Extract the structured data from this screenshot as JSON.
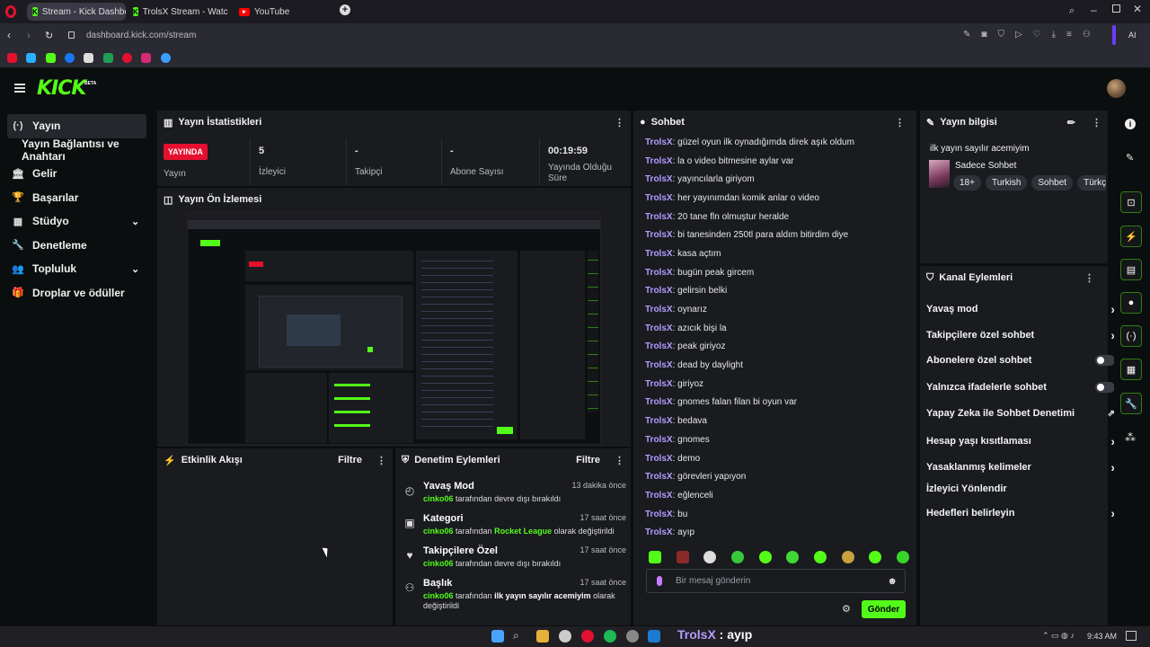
{
  "browser": {
    "tabs": [
      {
        "title": "Stream - Kick Dashboard"
      },
      {
        "title": "TrolsX Stream - Watch Liv"
      },
      {
        "title": "YouTube"
      }
    ],
    "new_tab": "+",
    "url": "dashboard.kick.com/stream",
    "ai_label": "AI"
  },
  "header": {
    "logo": "KICK",
    "logo_tag": "BETA"
  },
  "nav": {
    "items": [
      {
        "label": "Yayın",
        "icon": "broadcast-icon"
      },
      {
        "label": "Yayın Bağlantısı ve Anahtarı"
      },
      {
        "label": "Gelir",
        "icon": "bank-icon"
      },
      {
        "label": "Başarılar",
        "icon": "trophy-icon"
      },
      {
        "label": "Stüdyo",
        "icon": "studio-icon"
      },
      {
        "label": "Denetleme",
        "icon": "wrench-icon"
      },
      {
        "label": "Topluluk",
        "icon": "community-icon"
      },
      {
        "label": "Droplar ve ödüller",
        "icon": "drops-icon"
      }
    ]
  },
  "stats": {
    "title": "Yayın İstatistikleri",
    "live_badge": "YAYINDA",
    "live_label": "Yayın",
    "viewers_value": "5",
    "viewers_label": "İzleyici",
    "followers_value": "-",
    "followers_label": "Takipçi",
    "subs_value": "-",
    "subs_label": "Abone Sayısı",
    "duration_value": "00:19:59",
    "duration_label": "Yayında Olduğu Süre"
  },
  "preview": {
    "title": "Yayın Ön İzlemesi"
  },
  "activity": {
    "title": "Etkinlik Akışı",
    "filter": "Filtre"
  },
  "mod": {
    "title": "Denetim Eylemleri",
    "filter": "Filtre",
    "items": [
      {
        "title": "Yavaş Mod",
        "time": "13 dakika önce",
        "user": "cinko06",
        "pre": " tarafından devre dışı bırakıldı",
        "hl": "",
        "post": ""
      },
      {
        "title": "Kategori",
        "time": "17 saat önce",
        "user": "cinko06",
        "pre": " tarafından ",
        "hl": "Rocket League",
        "post": " olarak değiştirildi"
      },
      {
        "title": "Takipçilere Özel",
        "time": "17 saat önce",
        "user": "cinko06",
        "pre": " tarafından devre dışı bırakıldı",
        "hl": "",
        "post": ""
      },
      {
        "title": "Başlık",
        "time": "17 saat önce",
        "user": "cinko06",
        "pre": " tarafından ",
        "hl": "ilk yayın sayılır acemiyim",
        "post": " olarak değiştirildi"
      }
    ]
  },
  "chat": {
    "title": "Sohbet",
    "messages": [
      {
        "user": "TrolsX",
        "text": ": güzel oyun ilk oynadığımda direk aşık oldum"
      },
      {
        "user": "TrolsX",
        "text": ": la o video bitmesine aylar var"
      },
      {
        "user": "TrolsX",
        "text": ": yayıncılarla giriyom"
      },
      {
        "user": "TrolsX",
        "text": ": her yayınımdan komik anlar o video"
      },
      {
        "user": "TrolsX",
        "text": ": 20 tane fln olmuştur heralde"
      },
      {
        "user": "TrolsX",
        "text": ": bi tanesinden 250tl para aldım bitirdim diye"
      },
      {
        "user": "TrolsX",
        "text": ": kasa açtım"
      },
      {
        "user": "TrolsX",
        "text": ": bugün peak gircem"
      },
      {
        "user": "TrolsX",
        "text": ": gelirsin belki"
      },
      {
        "user": "TrolsX",
        "text": ": oynarız"
      },
      {
        "user": "TrolsX",
        "text": ": azıcık bişi la"
      },
      {
        "user": "TrolsX",
        "text": ": peak giriyoz"
      },
      {
        "user": "TrolsX",
        "text": ": dead by daylight"
      },
      {
        "user": "TrolsX",
        "text": ": giriyoz"
      },
      {
        "user": "TrolsX",
        "text": ": gnomes falan filan bi oyun var"
      },
      {
        "user": "TrolsX",
        "text": ": bedava"
      },
      {
        "user": "TrolsX",
        "text": ": gnomes"
      },
      {
        "user": "TrolsX",
        "text": ": demo"
      },
      {
        "user": "TrolsX",
        "text": ": görevleri yapıyon"
      },
      {
        "user": "TrolsX",
        "text": ": eğlenceli"
      },
      {
        "user": "TrolsX",
        "text": ": bu"
      },
      {
        "user": "TrolsX",
        "text": ": ayıp"
      }
    ],
    "placeholder": "Bir mesaj gönderin",
    "send": "Gönder"
  },
  "stream_info": {
    "title": "Yayın bilgisi",
    "stream_title": "ilk yayın sayılır acemiyim",
    "category": "Sadece Sohbet",
    "tags": [
      "18+",
      "Turkish",
      "Sohbet",
      "Türkçe"
    ]
  },
  "channel_actions": {
    "title": "Kanal Eylemleri",
    "items": [
      {
        "label": "Yavaş mod",
        "control": "chevron"
      },
      {
        "label": "Takipçilere özel sohbet",
        "control": "chevron"
      },
      {
        "label": "Abonelere özel sohbet",
        "control": "toggle"
      },
      {
        "label": "Yalnızca ifadelerle sohbet",
        "control": "toggle"
      },
      {
        "label": "Yapay Zeka ile Sohbet Denetimi",
        "control": "external"
      },
      {
        "label": "Hesap yaşı kısıtlaması",
        "control": "chevron"
      },
      {
        "label": "Yasaklanmış kelimeler",
        "control": "chevron"
      },
      {
        "label": "İzleyici Yönlendir",
        "control": "none"
      },
      {
        "label": "Hedefleri belirleyin",
        "control": "chevron"
      }
    ]
  },
  "overlay": {
    "user": "TrolsX",
    "text": " : ayıp"
  },
  "taskbar": {
    "time": "9:43 AM"
  },
  "colors": {
    "accent": "#53fc18",
    "username": "#b49cff",
    "live": "#e5102f"
  }
}
